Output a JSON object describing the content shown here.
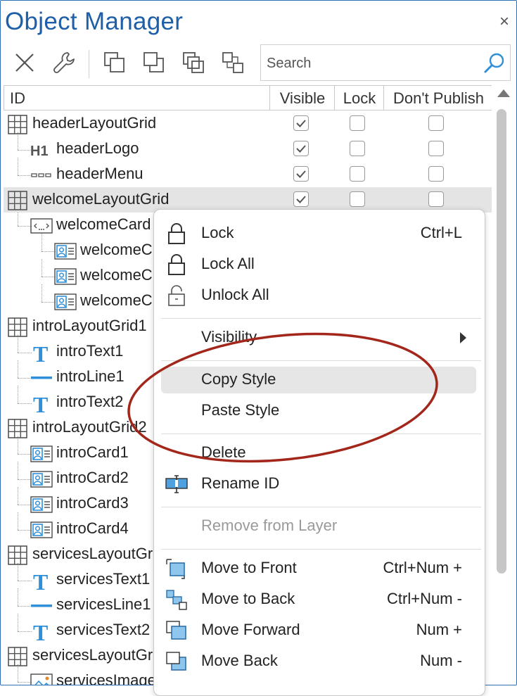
{
  "window": {
    "title": "Object Manager",
    "close_glyph": "×"
  },
  "toolbar": {
    "buttons": [
      {
        "icon": "delete-icon"
      },
      {
        "icon": "wrench-icon"
      },
      {
        "icon": "bring-to-front-icon"
      },
      {
        "icon": "send-to-back-icon"
      },
      {
        "icon": "bring-forward-icon"
      },
      {
        "icon": "send-backward-icon"
      }
    ],
    "search_placeholder": "Search"
  },
  "columns": {
    "id": "ID",
    "visible": "Visible",
    "lock": "Lock",
    "dont_publish": "Don't Publish"
  },
  "tree": [
    {
      "label": "headerLayoutGrid",
      "icon": "grid-icon",
      "level": 0,
      "visible": true,
      "lock": false,
      "dont_publish": false
    },
    {
      "label": "headerLogo",
      "icon": "h1-icon",
      "level": 1,
      "visible": true,
      "lock": false,
      "dont_publish": false
    },
    {
      "label": "headerMenu",
      "icon": "menu-icon",
      "level": 1,
      "visible": true,
      "lock": false,
      "dont_publish": false
    },
    {
      "label": "welcomeLayoutGrid",
      "icon": "grid-icon",
      "level": 0,
      "visible": true,
      "lock": false,
      "dont_publish": false,
      "selected": true
    },
    {
      "label": "welcomeCard",
      "icon": "container-icon",
      "level": 1
    },
    {
      "label": "welcomeC",
      "icon": "card-icon",
      "level": 2
    },
    {
      "label": "welcomeC",
      "icon": "card-icon",
      "level": 2
    },
    {
      "label": "welcomeC",
      "icon": "card-icon",
      "level": 2
    },
    {
      "label": "introLayoutGrid1",
      "icon": "grid-icon",
      "level": 0
    },
    {
      "label": "introText1",
      "icon": "text-icon",
      "level": 1
    },
    {
      "label": "introLine1",
      "icon": "line-icon",
      "level": 1
    },
    {
      "label": "introText2",
      "icon": "text-icon",
      "level": 1
    },
    {
      "label": "introLayoutGrid2",
      "icon": "grid-icon",
      "level": 0
    },
    {
      "label": "introCard1",
      "icon": "card-icon",
      "level": 1
    },
    {
      "label": "introCard2",
      "icon": "card-icon",
      "level": 1
    },
    {
      "label": "introCard3",
      "icon": "card-icon",
      "level": 1
    },
    {
      "label": "introCard4",
      "icon": "card-icon",
      "level": 1
    },
    {
      "label": "servicesLayoutGr",
      "icon": "grid-icon",
      "level": 0
    },
    {
      "label": "servicesText1",
      "icon": "text-icon",
      "level": 1
    },
    {
      "label": "servicesLine1",
      "icon": "line-icon",
      "level": 1
    },
    {
      "label": "servicesText2",
      "icon": "text-icon",
      "level": 1
    },
    {
      "label": "servicesLayoutGr",
      "icon": "grid-icon",
      "level": 0
    },
    {
      "label": "servicesImage",
      "icon": "image-icon",
      "level": 1
    }
  ],
  "context_menu": {
    "groups": [
      [
        {
          "label": "Lock",
          "shortcut": "Ctrl+L",
          "icon": "lock-icon"
        },
        {
          "label": "Lock All",
          "shortcut": "",
          "icon": "lock-icon"
        },
        {
          "label": "Unlock All",
          "shortcut": "",
          "icon": "unlock-icon"
        }
      ],
      [
        {
          "label": "Visibility",
          "shortcut": "",
          "icon": "",
          "submenu": true
        }
      ],
      [
        {
          "label": "Copy Style",
          "shortcut": "",
          "icon": "",
          "highlighted": true
        },
        {
          "label": "Paste Style",
          "shortcut": "",
          "icon": ""
        }
      ],
      [
        {
          "label": "Delete",
          "shortcut": "",
          "icon": ""
        },
        {
          "label": "Rename ID",
          "shortcut": "",
          "icon": "rename-icon"
        }
      ],
      [
        {
          "label": "Remove from Layer",
          "shortcut": "",
          "icon": "",
          "disabled": true
        }
      ],
      [
        {
          "label": "Move to Front",
          "shortcut": "Ctrl+Num +",
          "icon": "move-to-front-icon"
        },
        {
          "label": "Move to Back",
          "shortcut": "Ctrl+Num -",
          "icon": "move-to-back-icon"
        },
        {
          "label": "Move Forward",
          "shortcut": "Num +",
          "icon": "move-forward-icon"
        },
        {
          "label": "Move Back",
          "shortcut": "Num -",
          "icon": "move-back-icon"
        }
      ]
    ]
  },
  "colors": {
    "title": "#1d5fa8",
    "accent_blue": "#2f8fd8",
    "annotation_ring": "#a3261b",
    "selection": "#e4e4e4"
  }
}
